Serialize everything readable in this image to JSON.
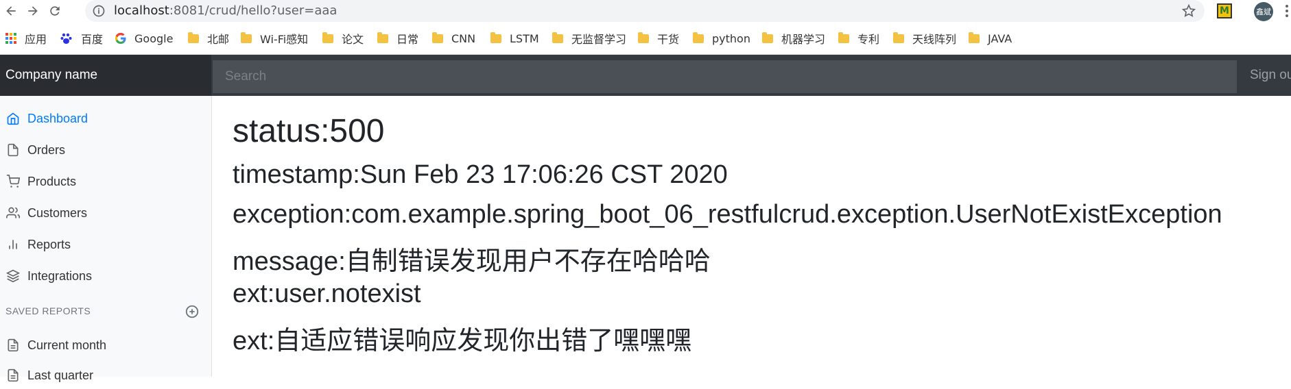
{
  "browser": {
    "url": "localhost:8081/crud/hello?user=aaa",
    "url_host": "localhost",
    "url_rest": ":8081/crud/hello?user=aaa",
    "extension_label": "M",
    "profile_label": "鑫斌",
    "bookmarks": [
      {
        "label": "应用",
        "icon": "apps-grid-icon"
      },
      {
        "label": "百度",
        "icon": "baidu-paw-icon"
      },
      {
        "label": "Google",
        "icon": "google-g-icon"
      },
      {
        "label": "北邮",
        "icon": "folder-icon"
      },
      {
        "label": "Wi-Fi感知",
        "icon": "folder-icon"
      },
      {
        "label": "论文",
        "icon": "folder-icon"
      },
      {
        "label": "日常",
        "icon": "folder-icon"
      },
      {
        "label": "CNN",
        "icon": "folder-icon"
      },
      {
        "label": "LSTM",
        "icon": "folder-icon"
      },
      {
        "label": "无监督学习",
        "icon": "folder-icon"
      },
      {
        "label": "干货",
        "icon": "folder-icon"
      },
      {
        "label": "python",
        "icon": "folder-icon"
      },
      {
        "label": "机器学习",
        "icon": "folder-icon"
      },
      {
        "label": "专利",
        "icon": "folder-icon"
      },
      {
        "label": "天线阵列",
        "icon": "folder-icon"
      },
      {
        "label": "JAVA",
        "icon": "folder-icon"
      }
    ]
  },
  "navbar": {
    "brand": "Company name",
    "search_placeholder": "Search",
    "signout": "Sign ou"
  },
  "sidebar": {
    "items": [
      {
        "label": "Dashboard",
        "icon": "home-icon",
        "active": true
      },
      {
        "label": "Orders",
        "icon": "file-icon"
      },
      {
        "label": "Products",
        "icon": "shopping-cart-icon"
      },
      {
        "label": "Customers",
        "icon": "users-icon"
      },
      {
        "label": "Reports",
        "icon": "bar-chart-icon"
      },
      {
        "label": "Integrations",
        "icon": "layers-icon"
      }
    ],
    "saved_reports_heading": "SAVED REPORTS",
    "saved_reports": [
      {
        "label": "Current month",
        "icon": "file-text-icon"
      },
      {
        "label": "Last quarter",
        "icon": "file-text-icon"
      }
    ]
  },
  "main": {
    "status": "status:500",
    "timestamp": "timestamp:Sun Feb 23 17:06:26 CST 2020",
    "exception": "exception:com.example.spring_boot_06_restfulcrud.exception.UserNotExistException",
    "message": "message:自制错误发现用户不存在哈哈哈",
    "ext1": "ext:user.notexist",
    "ext2": "ext:自适应错误响应发现你出错了嘿嘿嘿"
  },
  "colors": {
    "navbar": "#343a40",
    "brand_bg": "#292d32",
    "search_bg": "#4b5056",
    "active_link": "#007bff",
    "sidebar_bg": "#f8f9fa"
  }
}
